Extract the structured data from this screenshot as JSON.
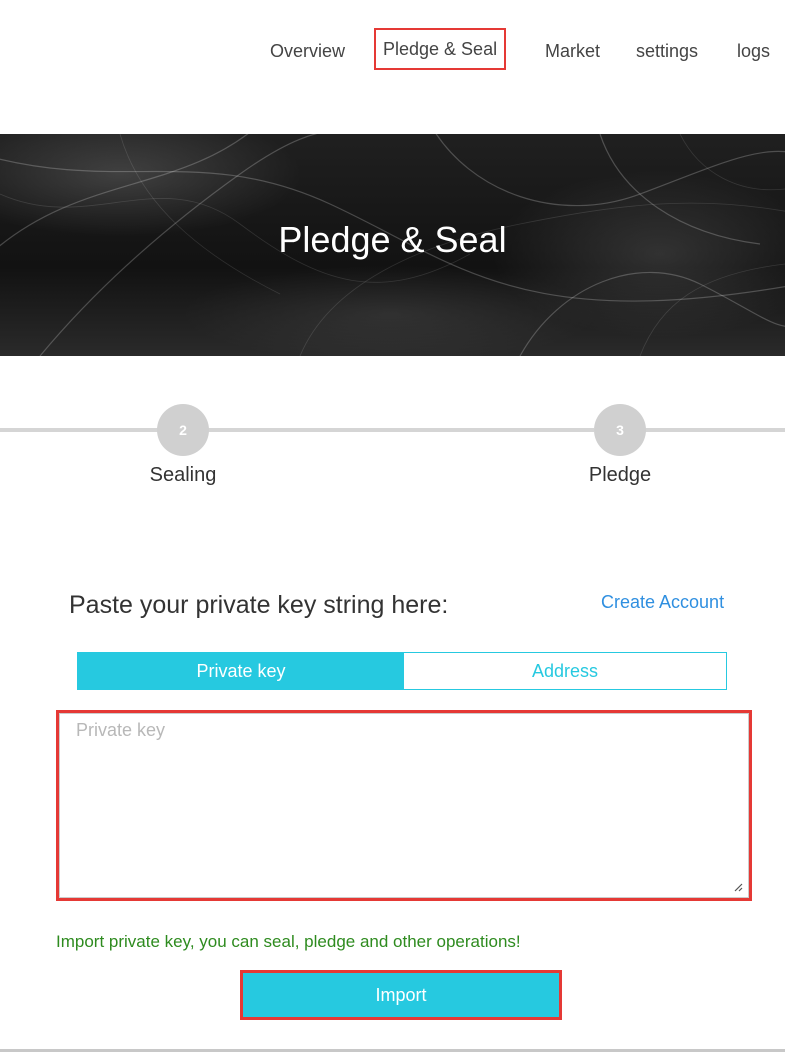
{
  "nav": {
    "items": [
      {
        "label": "Overview",
        "active": false
      },
      {
        "label": "Pledge & Seal",
        "active": true
      },
      {
        "label": "Market",
        "active": false
      },
      {
        "label": "settings",
        "active": false
      },
      {
        "label": "logs",
        "active": false
      }
    ]
  },
  "hero": {
    "title": "Pledge & Seal"
  },
  "steps": [
    {
      "number": "2",
      "label": "Sealing"
    },
    {
      "number": "3",
      "label": "Pledge"
    }
  ],
  "form": {
    "heading": "Paste your private key string here:",
    "create_account_label": "Create Account",
    "tabs": [
      {
        "label": "Private key",
        "active": true
      },
      {
        "label": "Address",
        "active": false
      }
    ],
    "private_key_value": "",
    "private_key_placeholder": "Private key",
    "hint": "Import private key, you can seal, pledge and other operations!",
    "import_label": "Import"
  },
  "colors": {
    "accent": "#26c9e0",
    "link": "#2f8fe0",
    "hint_text": "#2e8b1f",
    "highlight_border": "#e53935",
    "step_circle": "#d0d0d0"
  }
}
